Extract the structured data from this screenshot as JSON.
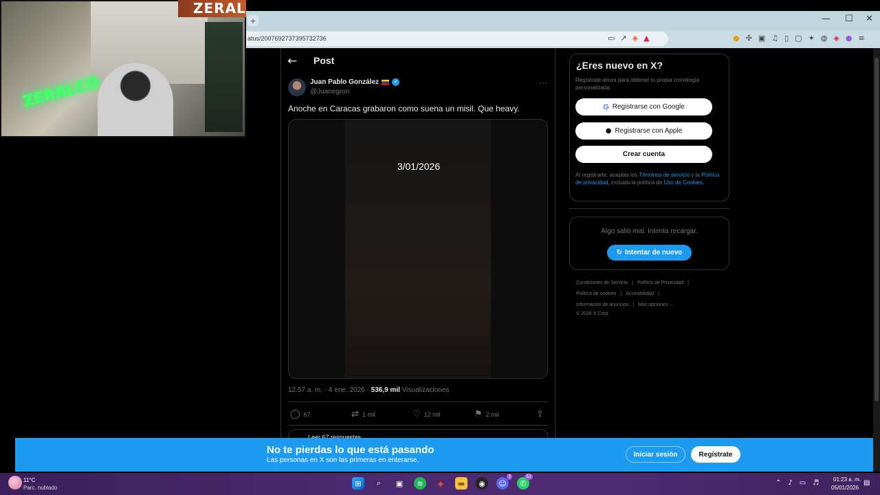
{
  "browser": {
    "url": "atus/2007692737395732736",
    "new_tab_label": "+",
    "win_min": "—",
    "win_max": "☐",
    "win_close": "✕"
  },
  "overlay": {
    "brand": "ZERAL",
    "neon_text": "ZERALCO"
  },
  "post_header": {
    "back": "←",
    "title": "Post"
  },
  "tweet": {
    "author_name": "Juan Pablo González",
    "handle": "@Juanegron",
    "more": "···",
    "text": "Anoche en Caracas grabaron como suena un misil. Que heavy.",
    "media_overlay_text": "3/01/2026",
    "time": "12:57 a. m. · 4 ene. 2026 · ",
    "views_count": "536,9 mil",
    "views_label": " Visualizaciones",
    "replies": "67",
    "reposts": "1 mil",
    "likes": "12 mil",
    "bookmarks": "2 mil",
    "read_replies": "Leer 67 respuestas"
  },
  "sidebar": {
    "title": "¿Eres nuevo en X?",
    "subtitle": "Regístrate ahora para obtener tu propia cronología personalizada.",
    "google_btn": "Registrarse con Google",
    "apple_btn": "Registrarse con Apple",
    "create_btn": "Crear cuenta",
    "legal_pre": "Al registrarte, aceptas los ",
    "legal_terms": "Términos de servicio",
    "legal_mid": " y la ",
    "legal_privacy": "Política de privacidad",
    "legal_mid2": ", incluida la política de ",
    "legal_cookies": "Uso de Cookies",
    "legal_end": ".",
    "error_text": "Algo salió mal. Intenta recargar.",
    "retry_btn": "Intentar de nuevo",
    "footer": {
      "row1": [
        "Condiciones de Servicio",
        "|",
        "Política de Privacidad",
        "|"
      ],
      "row2": [
        "Política de cookies",
        "|",
        "Accesibilidad",
        "|"
      ],
      "row3": [
        "Información de anuncios",
        "|",
        "Más opciones ···"
      ],
      "copyright": "© 2026 X Corp."
    }
  },
  "banner": {
    "title": "No te pierdas lo que está pasando",
    "subtitle": "Las personas en X son las primeras en enterarse.",
    "login": "Iniciar sesión",
    "register": "Regístrate"
  },
  "taskbar": {
    "temperature": "11°C",
    "weather": "Parc. nublado",
    "time": "01:23 a. m.",
    "date": "05/01/2026",
    "discord_badge": "3",
    "whatsapp_badge": "52"
  },
  "colors": {
    "accent": "#1d9bf0",
    "background": "#000000",
    "muted_text": "#71767b"
  }
}
